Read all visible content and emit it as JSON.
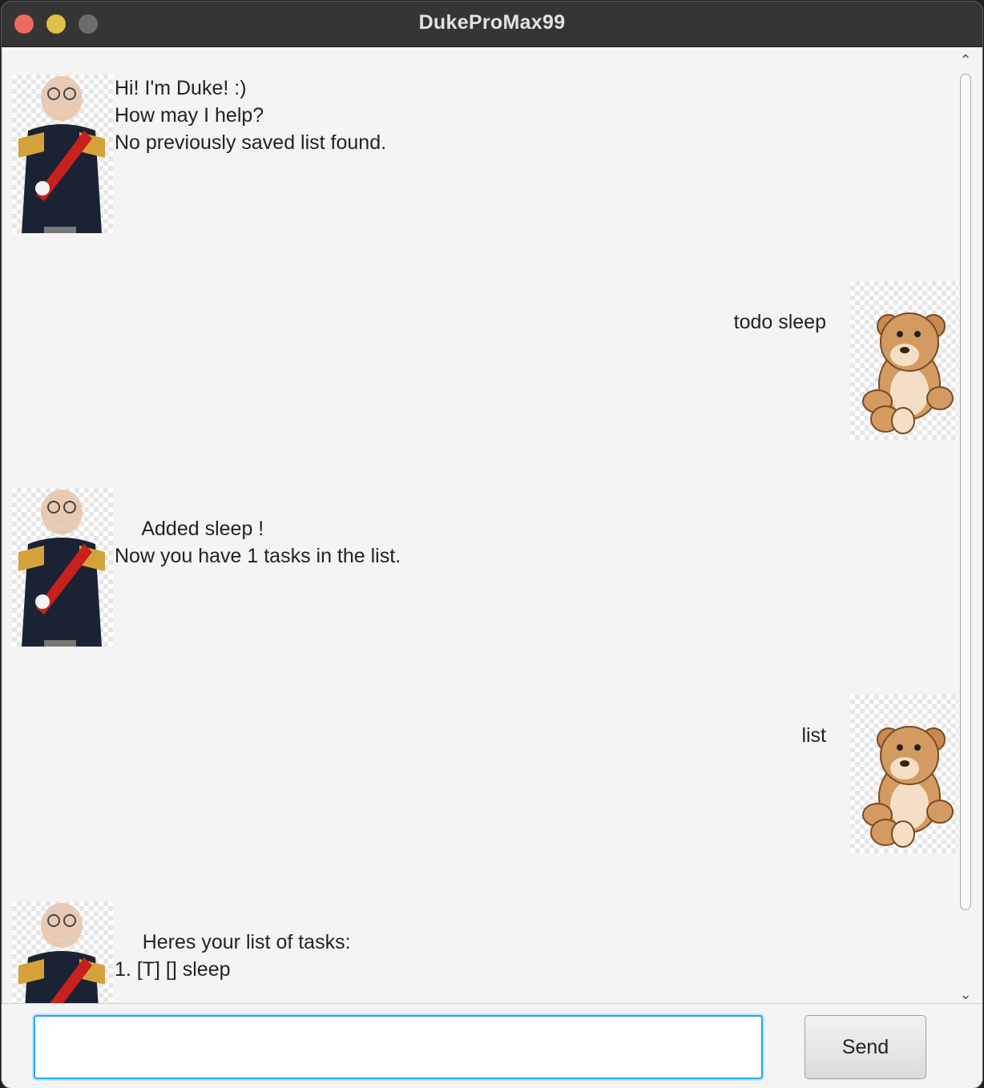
{
  "window": {
    "title": "DukeProMax99"
  },
  "messages": [
    {
      "sender": "duke",
      "lines": [
        "Hi! I'm Duke! :)",
        "How may I help?",
        "No previously saved list found."
      ]
    },
    {
      "sender": "user",
      "text": "todo sleep"
    },
    {
      "sender": "duke",
      "lines": [
        "     Added sleep !",
        "Now you have 1 tasks in the list."
      ]
    },
    {
      "sender": "user",
      "text": "list"
    },
    {
      "sender": "duke",
      "lines": [
        "     Heres your list of tasks:",
        "1. [T] [] sleep"
      ]
    }
  ],
  "input": {
    "value": "",
    "placeholder": ""
  },
  "send_button": {
    "label": "Send"
  },
  "icons": {
    "duke_avatar": "duke-general-icon",
    "user_avatar": "teddy-bear-icon",
    "scroll_up": "chevron-up-icon",
    "scroll_down": "chevron-down-icon"
  },
  "colors": {
    "input_focus": "#27a5e6",
    "titlebar": "#353535",
    "close": "#ed6a5e",
    "minimize": "#e0c147"
  }
}
